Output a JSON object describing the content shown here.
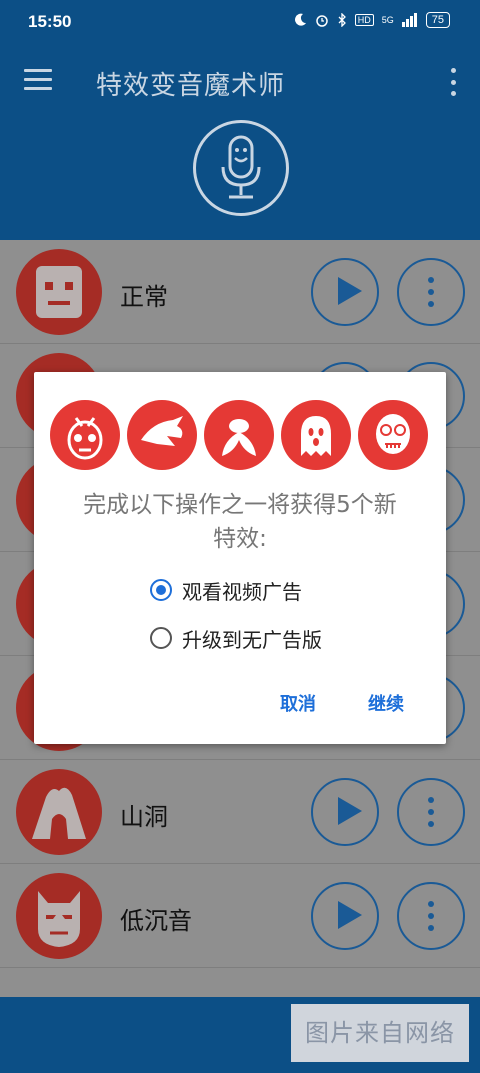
{
  "status_bar": {
    "time": "15:50",
    "network": "5G",
    "battery": "75"
  },
  "app_bar": {
    "title": "特效变音魔术师"
  },
  "effects": [
    {
      "label": "正常"
    },
    {
      "label": ""
    },
    {
      "label": ""
    },
    {
      "label": ""
    },
    {
      "label": ""
    },
    {
      "label": "山洞"
    },
    {
      "label": "低沉音"
    }
  ],
  "dialog": {
    "message": "完成以下操作之一将获得5个新特效:",
    "options": [
      {
        "label": "观看视频广告",
        "selected": true
      },
      {
        "label": "升级到无广告版",
        "selected": false
      }
    ],
    "cancel": "取消",
    "continue": "继续",
    "badge_icons": [
      "alien-icon",
      "dragon-icon",
      "fly-icon",
      "ghost-icon",
      "jigsaw-icon"
    ]
  },
  "watermark": "图片来自网络",
  "colors": {
    "primary": "#0c4f86",
    "accent": "#e53935",
    "button": "#1a5a96",
    "link": "#1e6fd9"
  }
}
